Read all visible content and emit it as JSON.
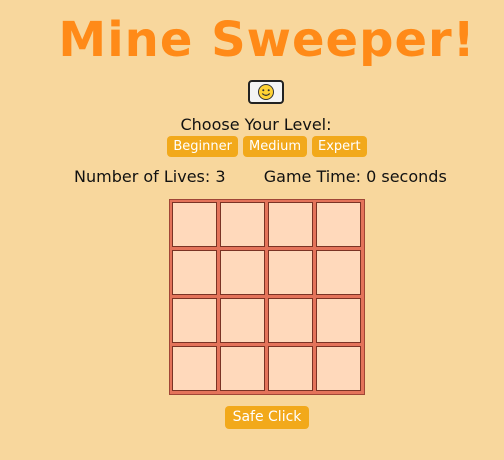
{
  "title": "Mine Sweeper!",
  "smiley_icon": "smiley-face-icon",
  "level": {
    "label": "Choose Your Level:",
    "options": [
      "Beginner",
      "Medium",
      "Expert"
    ]
  },
  "stats": {
    "lives_label": "Number of Lives:",
    "lives_value": "3",
    "time_label": "Game Time:",
    "time_value": "0",
    "time_unit": "seconds"
  },
  "board": {
    "rows": 4,
    "cols": 4
  },
  "safe_click_label": "Safe Click",
  "colors": {
    "background": "#f8d79d",
    "title": "#ff8a18",
    "button": "#f2a91b",
    "cell": "#ffd9bb",
    "board": "#e4735a"
  }
}
